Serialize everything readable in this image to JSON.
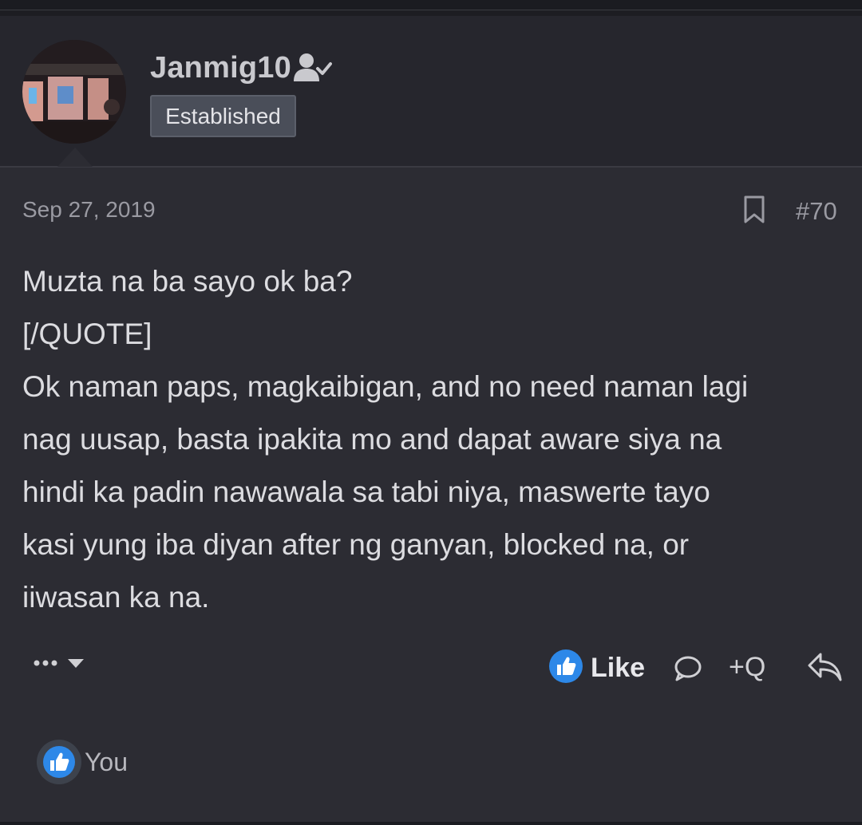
{
  "post": {
    "username": "Janmig10",
    "user_title": "Established",
    "date": "Sep 27, 2019",
    "post_number": "#70",
    "body_lines": [
      "Muzta na ba sayo ok ba?",
      "[/QUOTE]",
      "Ok naman paps, magkaibigan, and no need naman lagi",
      "nag uusap, basta ipakita mo and dapat aware siya na",
      "hindi ka padin nawawala sa tabi niya, maswerte tayo",
      "kasi yung iba diyan after ng ganyan, blocked na, or",
      "iiwasan ka na."
    ],
    "actions": {
      "like_label": "Like",
      "quote_label": "+Q"
    },
    "reactions": {
      "text": "You"
    }
  },
  "colors": {
    "accent_blue": "#2d88e8",
    "background": "#2c2c33",
    "header_background": "#26262d"
  },
  "icons": [
    "verified-user-icon",
    "bookmark-icon",
    "more-options-icon",
    "like-thumb-icon",
    "comment-icon",
    "reply-icon"
  ]
}
